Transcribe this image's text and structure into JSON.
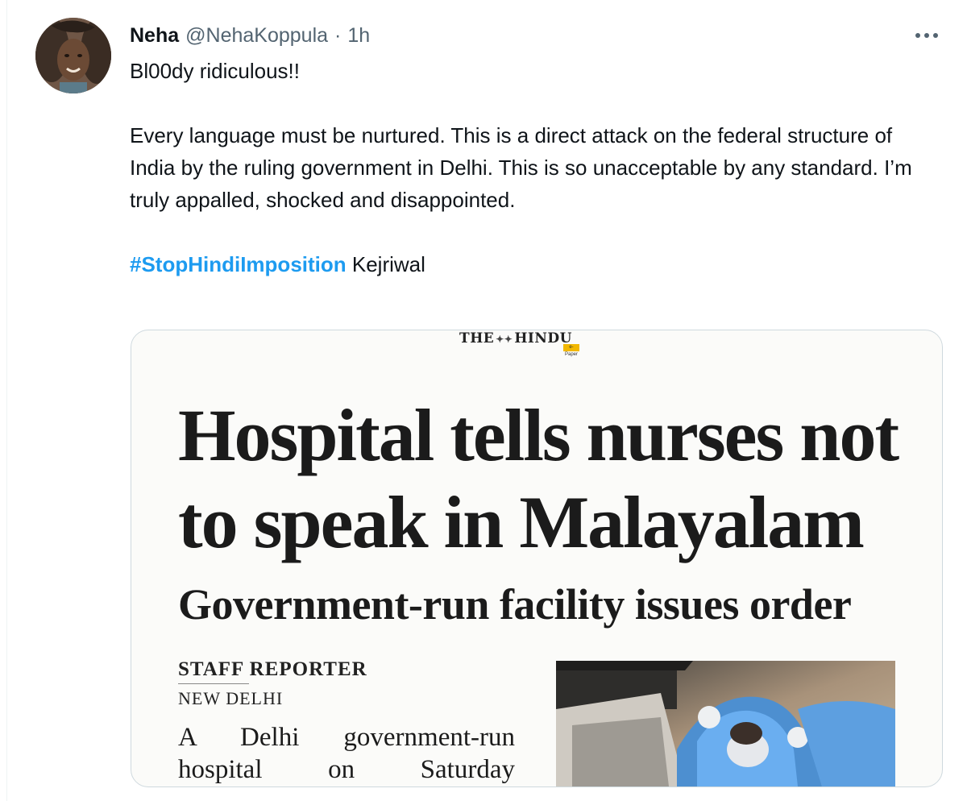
{
  "tweet": {
    "author_name": "Neha",
    "handle": "@NehaKoppula",
    "separator": "·",
    "time": "1h",
    "line1": "Bl00dy ridiculous!!",
    "paragraph": "Every language must be nurtured. This is a direct attack on the federal structure of India by the ruling government in Delhi. This is so unacceptable by any standard. I’m truly appalled, shocked and disappointed.",
    "hashtag": "#StopHindiImposition",
    "trailing_text": " Kejriwal"
  },
  "icons": {
    "more": "more-horizontal-icon",
    "avatar": "profile-photo"
  },
  "colors": {
    "link_blue": "#1d9bf0",
    "secondary_text": "#536471",
    "border": "#cfd9de"
  },
  "media": {
    "paper_name_left": "THE",
    "paper_name_right": "HINDU",
    "epaper_label": "e-Paper",
    "headline": "Hospital tells nurses not to speak in Malayalam",
    "subheadline": "Government-run facility issues order",
    "byline": "STAFF REPORTER",
    "dateline": "NEW DELHI",
    "body_line1": "A Delhi government-run",
    "body_line2": "hospital on Saturday"
  }
}
